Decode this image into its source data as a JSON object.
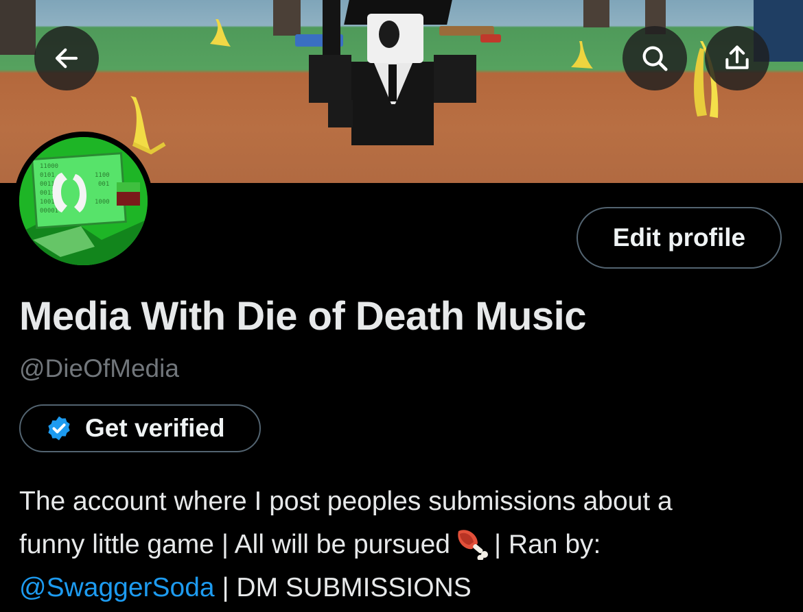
{
  "header": {
    "back_icon": "arrow-left-icon",
    "search_icon": "search-icon",
    "share_icon": "share-icon"
  },
  "profile": {
    "display_name": "Media With Die of Death Music",
    "handle": "@DieOfMedia",
    "edit_label": "Edit profile",
    "verify_label": "Get verified",
    "verify_icon": "verified-badge-icon"
  },
  "bio": {
    "line1": "The account where I post peoples submissions about a",
    "line2_a": "funny little game | All will be pursued",
    "line2_emoji": "meat-on-bone-icon",
    "line2_b": "| Ran by:",
    "mention": "@SwaggerSoda",
    "line3_rest": " | DM SUBMISSIONS"
  },
  "colors": {
    "background": "#000000",
    "accent": "#1d9bf0",
    "secondary_text": "#71767b",
    "border": "#536471"
  }
}
